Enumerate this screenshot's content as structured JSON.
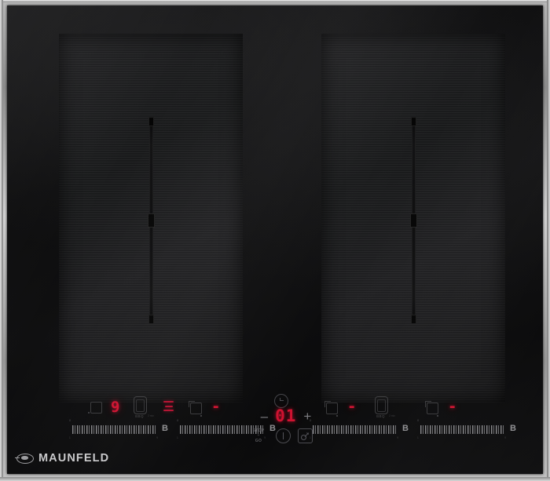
{
  "product": {
    "brand": "MAUNFELD",
    "brand_mark_icon": "maunfeld-oval-logo-icon",
    "type": "induction-cooktop",
    "frame_color": "#b9b9b9",
    "glass_color": "#0c0c0d",
    "display_red": "#cf1230",
    "icon_gray": "#4b4b50"
  },
  "zones": {
    "left": {
      "name": "left-flex-zone",
      "divider": "bridge-divider"
    },
    "right": {
      "name": "right-flex-zone",
      "divider": "bridge-divider"
    }
  },
  "controls": {
    "left_group": {
      "front_zone": {
        "icon": "zone-front-icon",
        "level": "9",
        "slider": {
          "min_label": "1",
          "max_label": "9",
          "zero_label": "0",
          "boost_label": "B"
        }
      },
      "bbq": {
        "icon": "bbq-grill-icon",
        "label": "BBQ",
        "sub_label": "2 min"
      },
      "level_bars_icon": "power-level-bars-icon",
      "rear_zone": {
        "icon": "zone-rear-icon",
        "level": "-",
        "slider": {
          "min_label": "1",
          "max_label": "9",
          "zero_label": "0",
          "boost_label": "B"
        }
      }
    },
    "center": {
      "timer_icon": "clock-timer-icon",
      "minus_label": "–",
      "plus_label": "+",
      "timer_value": "01",
      "stop_go": {
        "line1": "STOP",
        "line2": "+",
        "line3": "GO"
      },
      "power_icon": "power-button-icon",
      "lock_icon": "key-lock-icon"
    },
    "right_group": {
      "front_zone": {
        "icon": "zone-front-icon",
        "level": "-",
        "slider": {
          "min_label": "1",
          "max_label": "9",
          "zero_label": "0",
          "boost_label": "B"
        }
      },
      "bbq": {
        "icon": "bbq-grill-icon",
        "label": "BBQ",
        "sub_label": "2 min"
      },
      "rear_zone": {
        "icon": "zone-rear-icon",
        "level": "-",
        "slider": {
          "min_label": "1",
          "max_label": "9",
          "zero_label": "0",
          "boost_label": "B"
        }
      }
    }
  }
}
